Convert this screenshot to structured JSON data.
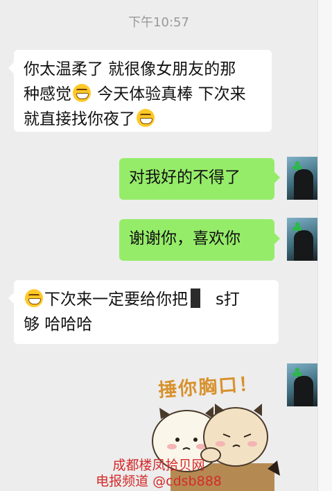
{
  "chat": {
    "timestamp": "下午10:57",
    "messages": [
      {
        "direction": "incoming",
        "lines": [
          "你太温柔了 就很像女朋友的那",
          "种感觉",
          " 今天体验真棒 下次来",
          "就直接找你夜了"
        ]
      },
      {
        "direction": "outgoing",
        "text": "对我好的不得了"
      },
      {
        "direction": "outgoing",
        "text": "谢谢你，喜欢你"
      },
      {
        "direction": "incoming",
        "line1": "下次来一定要给你把",
        "line1_tail": "s打",
        "line2": "够 哈哈哈"
      }
    ],
    "sticker": {
      "caption": "捶你胸口！"
    }
  },
  "watermark": {
    "line1": "成都楼凤拾贝网",
    "line2": "电报频道 @cdsb888"
  },
  "colors": {
    "background": "#ededed",
    "outgoing_bubble": "#95ec69",
    "incoming_bubble": "#ffffff",
    "watermark": "#d42a2a"
  }
}
